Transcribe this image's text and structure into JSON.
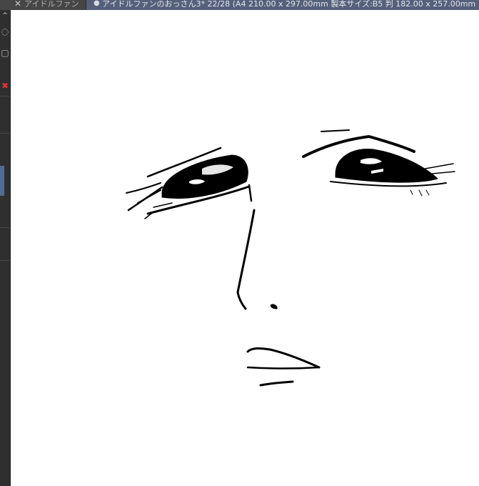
{
  "tabs": [
    {
      "label": "アイドルファン",
      "active": false,
      "close_glyph": "✕"
    },
    {
      "label": "アイドルファンのおっさん3* 22/28 (A4 210.00 x 297.00mm 製本サイズ:B5 判 182.00 x 257.00mm",
      "active": true,
      "modified_glyph": "●"
    }
  ],
  "colors": {
    "tabbar_bg": "#3a3a3a",
    "active_tab_bg": "#55607a",
    "toolbar_bg": "#2f2f2f",
    "canvas_bg": "#ffffff",
    "ink": "#000000",
    "selected_tool": "#4f6d94"
  },
  "tools": [
    {
      "icon": "chevron-up-down-icon",
      "glyph": "⌃"
    },
    {
      "icon": "lasso-icon",
      "glyph": "◌"
    },
    {
      "icon": "bucket-icon",
      "glyph": "▢"
    },
    {
      "icon": "eraser-icon",
      "glyph": "✖"
    }
  ]
}
